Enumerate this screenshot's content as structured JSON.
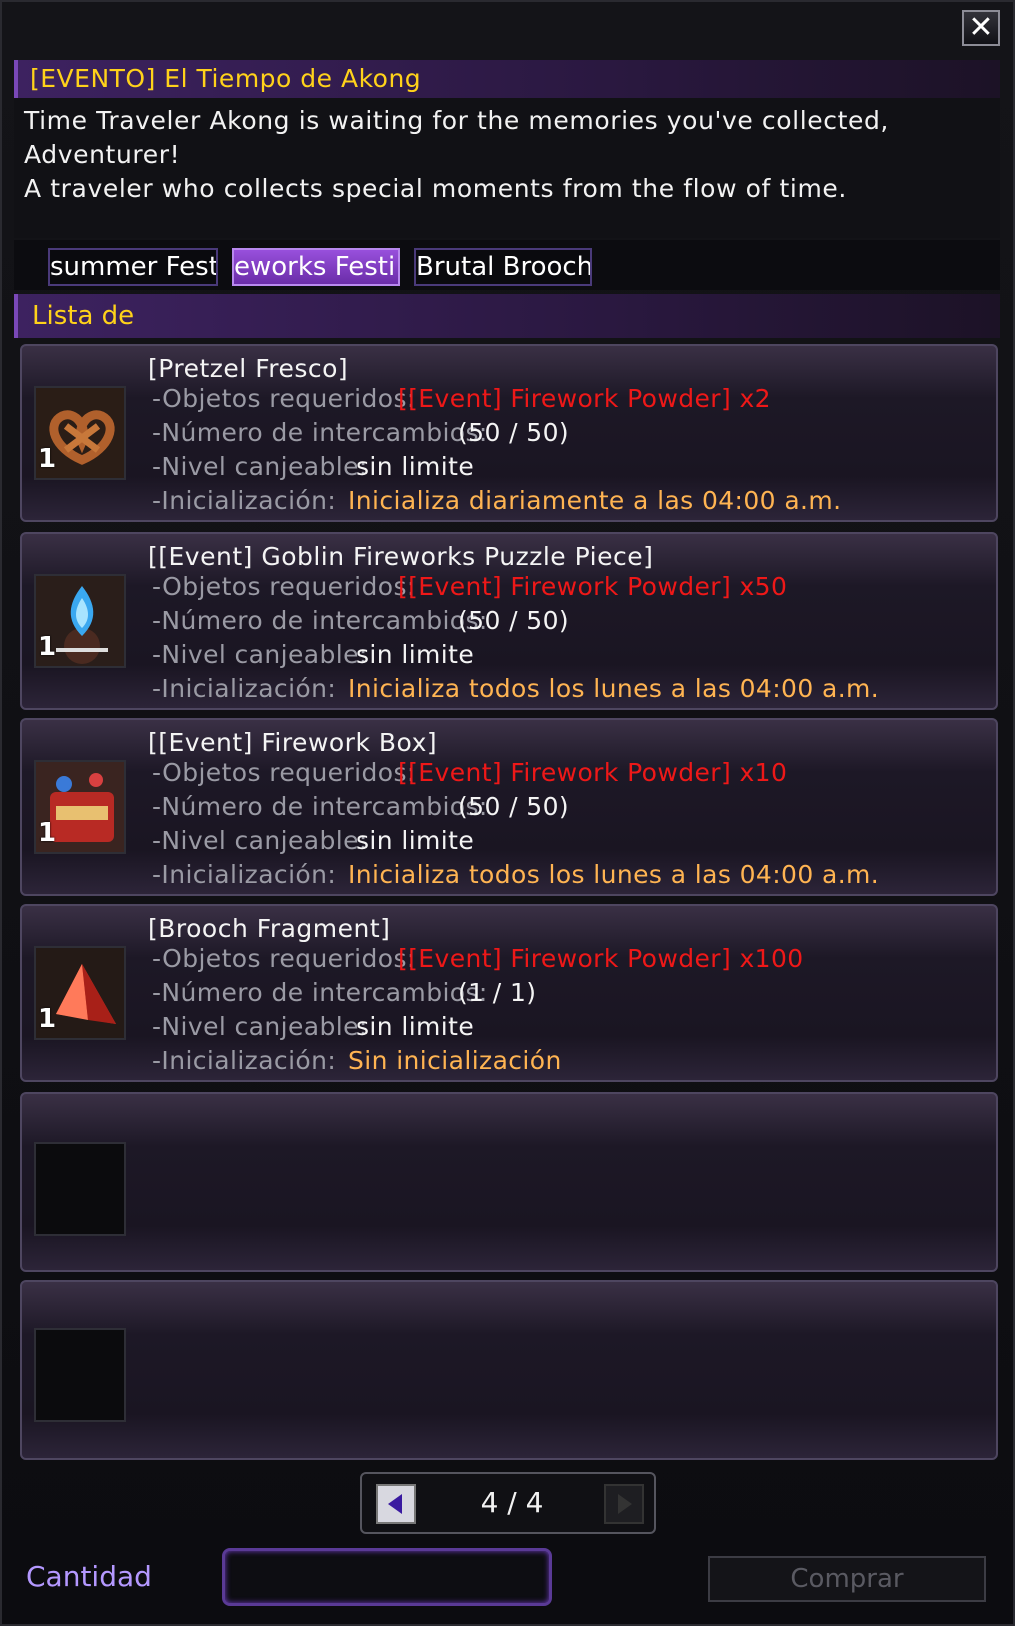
{
  "window": {
    "close_icon": "close-icon",
    "title": "[EVENTO] El Tiempo de Akong",
    "description": [
      "Time Traveler Akong is waiting for the memories you've collected, Adventurer!",
      "",
      "A traveler who collects special moments from the flow of time."
    ]
  },
  "tabs": [
    {
      "label": "summer Festi",
      "active": false
    },
    {
      "label": "eworks Festi",
      "active": true
    },
    {
      "label": "Brutal Brooch",
      "active": false
    }
  ],
  "list": {
    "header": "Lista de",
    "labels": {
      "required": "-Objetos requeridos:",
      "exchanges": "-Número de intercambios:",
      "level": "-Nivel canjeable:",
      "reset": "-Inicialización:"
    },
    "items": [
      {
        "name": "[Pretzel Fresco]",
        "icon": "pretzel-icon",
        "quantity": "1",
        "required": "[[Event] Firework Powder] x2",
        "exchanges": "(50 / 50)",
        "level": "sin limite",
        "reset": "Inicializa diariamente a las 04:00 a.m."
      },
      {
        "name": "[[Event] Goblin Fireworks Puzzle Piece]",
        "icon": "puzzle-piece-icon",
        "quantity": "1",
        "required": "[[Event] Firework Powder] x50",
        "exchanges": "(50 / 50)",
        "level": "sin limite",
        "reset": "Inicializa todos los lunes a las 04:00 a.m."
      },
      {
        "name": "[[Event] Firework Box]",
        "icon": "firework-box-icon",
        "quantity": "1",
        "required": "[[Event] Firework Powder] x10",
        "exchanges": "(50 / 50)",
        "level": "sin limite",
        "reset": "Inicializa todos los lunes a las 04:00 a.m."
      },
      {
        "name": "[Brooch Fragment]",
        "icon": "brooch-fragment-icon",
        "quantity": "1",
        "required": "[[Event] Firework Powder] x100",
        "exchanges": "(1 / 1)",
        "level": "sin limite",
        "reset": "Sin inicialización"
      }
    ]
  },
  "pager": {
    "page": "4 / 4",
    "prev_icon": "arrow-left-icon",
    "next_icon": "arrow-right-icon"
  },
  "footer": {
    "quantity_label": "Cantidad",
    "buy_label": "Comprar"
  },
  "colors": {
    "title_text": "#ffd21a",
    "required_text": "#ee1818",
    "reset_text": "#ffb452",
    "quantity_label": "#b498ff"
  }
}
